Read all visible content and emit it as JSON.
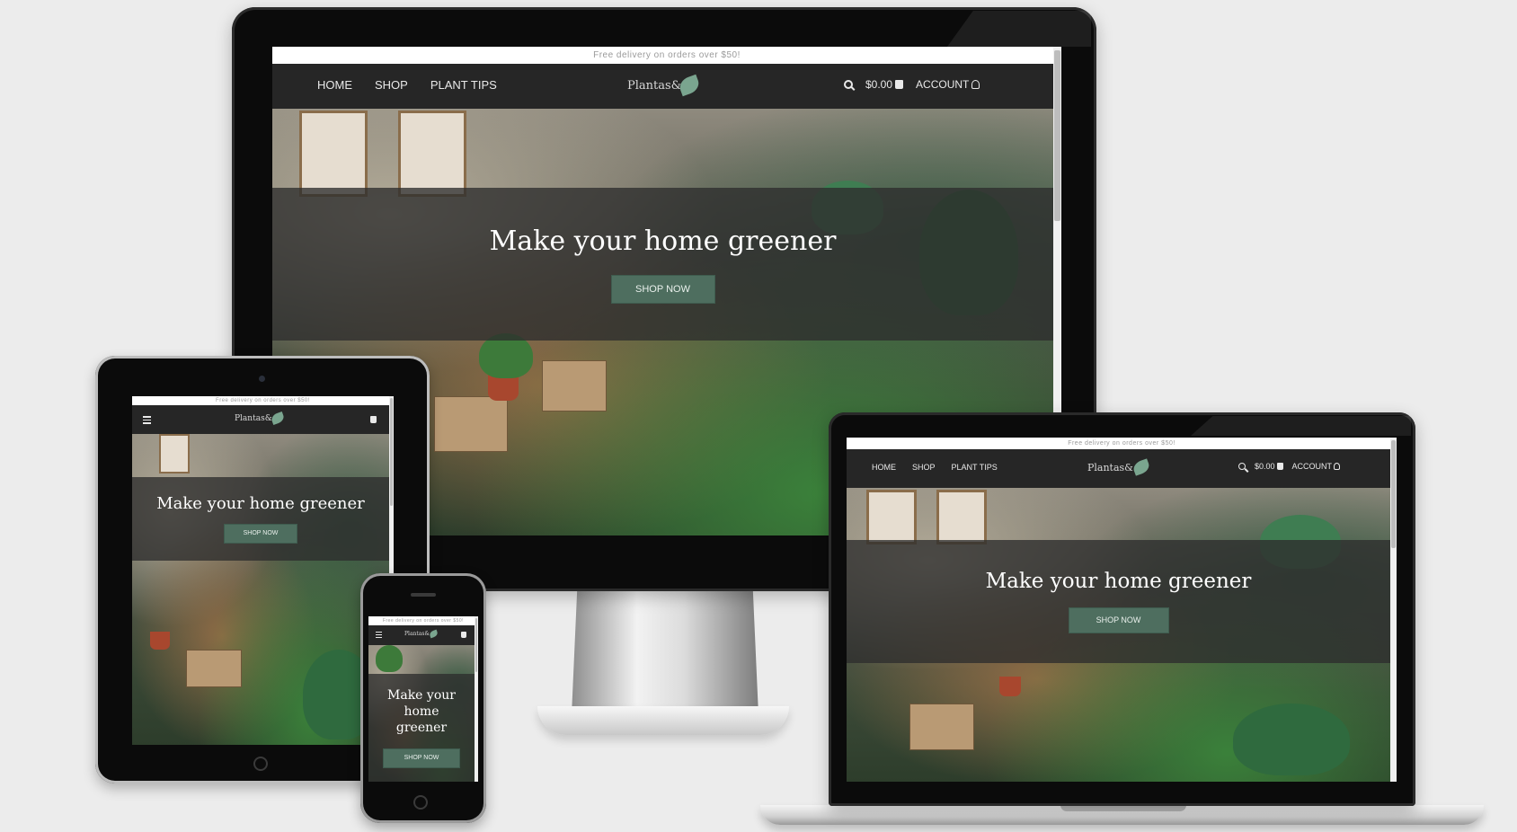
{
  "site": {
    "promo": "Free delivery on orders over $50!",
    "logo_text": "Plantas&",
    "nav": [
      "HOME",
      "SHOP",
      "PLANT TIPS"
    ],
    "cart_total": "$0.00",
    "account_label": "ACCOUNT",
    "headline": "Make your home greener",
    "cta": "SHOP NOW",
    "icons": [
      "search-icon",
      "shopping-bag-icon",
      "user-icon",
      "hamburger-menu-icon",
      "leaf-logo-icon"
    ],
    "colors": {
      "nav_bg": "#262626",
      "cta_bg": "#4e6e5f",
      "band": "#2d2d2d",
      "page": "#ececec"
    }
  }
}
